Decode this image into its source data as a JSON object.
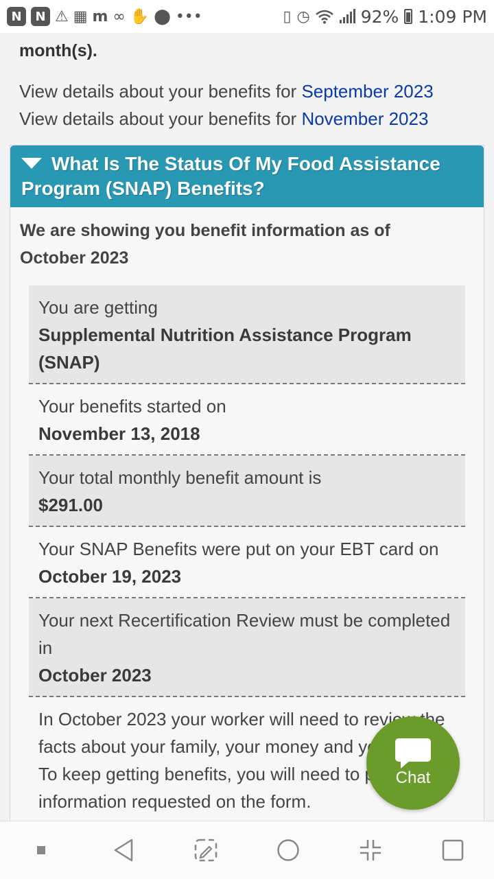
{
  "status_bar": {
    "battery": "92%",
    "time": "1:09 PM",
    "icons": [
      "app-n-icon",
      "app-n-icon",
      "warning-icon",
      "game-icon",
      "app-m-icon",
      "voicemail-icon",
      "hand-icon",
      "location-icon",
      "more-icon",
      "vibrate-icon",
      "alarm-icon",
      "wifi-icon",
      "signal-icon",
      "battery-icon"
    ]
  },
  "intro": {
    "partial_text": "month(s).",
    "month_links": [
      {
        "prefix": "View details about your benefits for ",
        "link": "September 2023"
      },
      {
        "prefix": "View details about your benefits for ",
        "link": "November 2023"
      }
    ]
  },
  "panel": {
    "title": "What Is The Status Of My Food Assistance Program (SNAP) Benefits?",
    "showing": "We are showing you benefit information as of October 2023",
    "rows": [
      {
        "label": "You are getting",
        "value": "Supplemental Nutrition Assistance Program (SNAP)"
      },
      {
        "label": "Your benefits started on",
        "value": "November 13, 2018"
      },
      {
        "label": "Your total monthly benefit amount is",
        "value": "$291.00"
      },
      {
        "label": "Your SNAP Benefits were put on your EBT card on",
        "value": "October 19, 2023"
      },
      {
        "label": "Your next Recertification Review must be completed in",
        "value": "October 2023"
      }
    ],
    "footer_text": "In October 2023 your worker will need to review the facts about your family, your money and your bills. To keep getting benefits, you will need to provide the information requested on the form."
  },
  "chat": {
    "label": "Chat"
  },
  "nav_bar": {
    "icons": [
      "menu-square-icon",
      "back-icon",
      "screenshot-edit-icon",
      "home-icon",
      "minimize-icon",
      "recents-icon"
    ]
  },
  "colors": {
    "header": "#2999b3",
    "link": "#0a3aa8",
    "chat": "#6b9b2a"
  }
}
